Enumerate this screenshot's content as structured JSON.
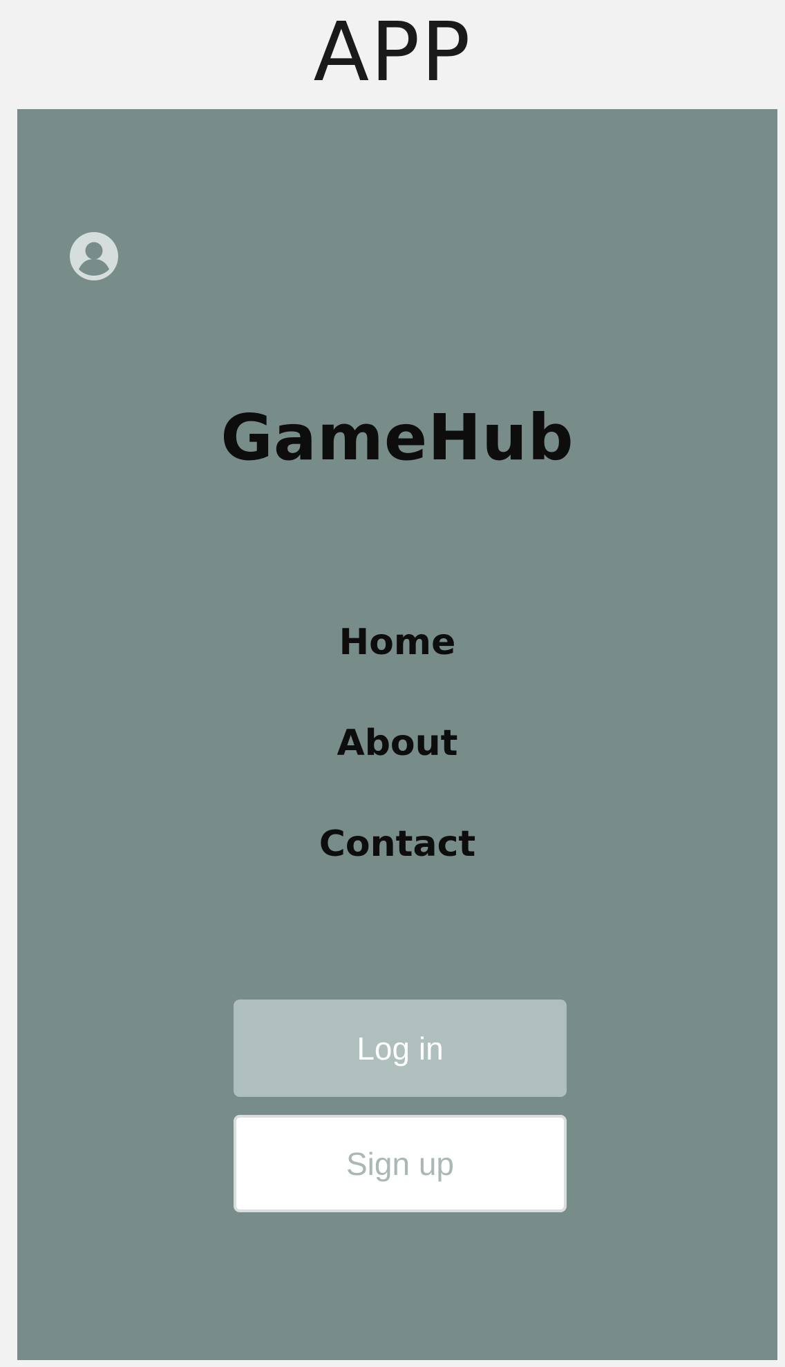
{
  "page": {
    "title": "APP"
  },
  "app": {
    "brand": "GameHub",
    "avatar_icon": "user-circle-icon",
    "nav": {
      "items": [
        {
          "label": "Home"
        },
        {
          "label": "About"
        },
        {
          "label": "Contact"
        }
      ]
    },
    "actions": {
      "login_label": "Log in",
      "signup_label": "Sign up"
    }
  },
  "colors": {
    "page_background": "#f2f2f2",
    "screen_background": "#788c8a",
    "login_button": "#afbfbd",
    "signup_button": "#ffffff",
    "signup_text": "#a9b7b5",
    "avatar_icon": "#d6dedd"
  }
}
